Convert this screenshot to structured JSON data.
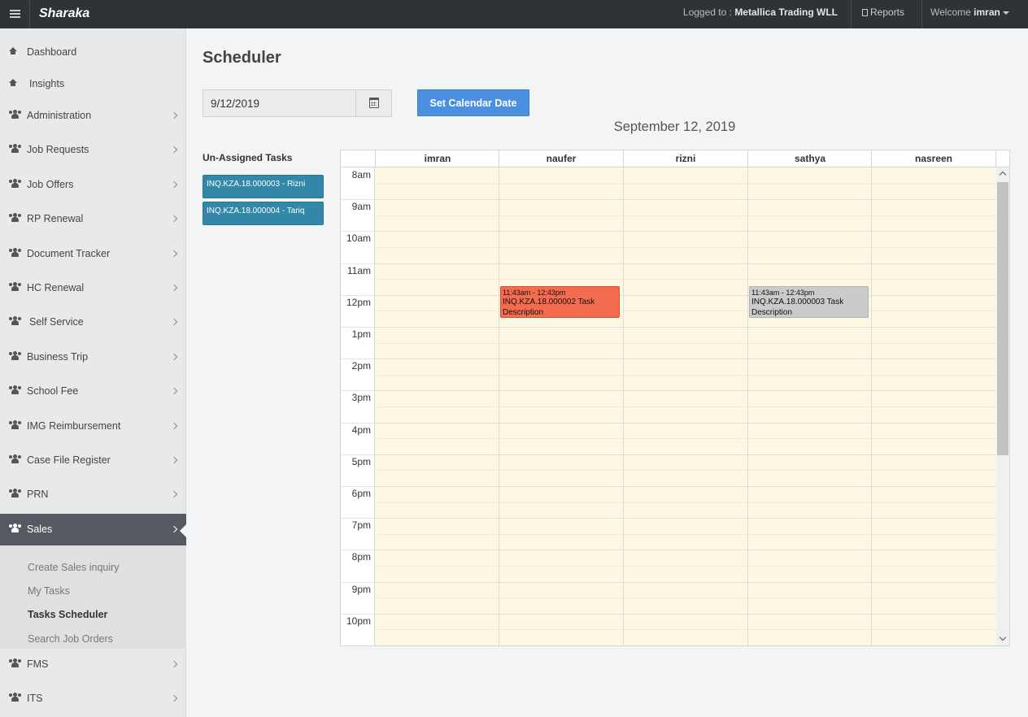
{
  "app": {
    "brand": "Sharaka"
  },
  "topbar": {
    "logged_label": "Logged to :",
    "company": "Metallica Trading WLL",
    "reports": "Reports",
    "welcome_label": "Welcome",
    "user": "imran"
  },
  "sidebar": {
    "items": [
      {
        "label": "Dashboard",
        "icon": "home-icon"
      },
      {
        "label": "Insights",
        "icon": "home-icon"
      },
      {
        "label": "Administration",
        "icon": "users-icon"
      },
      {
        "label": "Job Requests",
        "icon": "users-icon"
      },
      {
        "label": "Job Offers",
        "icon": "users-icon"
      },
      {
        "label": "RP Renewal",
        "icon": "users-icon"
      },
      {
        "label": "Document Tracker",
        "icon": "users-icon"
      },
      {
        "label": "HC Renewal",
        "icon": "users-icon"
      },
      {
        "label": "Self Service",
        "icon": "users-icon"
      },
      {
        "label": "Business Trip",
        "icon": "users-icon"
      },
      {
        "label": "School Fee",
        "icon": "users-icon"
      },
      {
        "label": "IMG Reimbursement",
        "icon": "users-icon"
      },
      {
        "label": "Case File Register",
        "icon": "users-icon"
      },
      {
        "label": "PRN",
        "icon": "users-icon"
      },
      {
        "label": "Sales",
        "icon": "users-icon",
        "active": true
      },
      {
        "label": "FMS",
        "icon": "users-icon"
      },
      {
        "label": "ITS",
        "icon": "users-icon"
      }
    ],
    "sales_submenu": [
      "Create Sales inquiry",
      "My Tasks",
      "Tasks Scheduler",
      "Search Job Orders"
    ],
    "current_submenu": "Tasks Scheduler"
  },
  "main": {
    "title": "Scheduler",
    "date_value": "9/12/2019",
    "set_button": "Set Calendar Date",
    "calendar_date": "September 12, 2019",
    "unassigned_title": "Un-Assigned Tasks",
    "unassigned_tasks": [
      "INQ.KZA.18.000003 - Rizni",
      "INQ.KZA.18.000004 - Tariq"
    ]
  },
  "scheduler": {
    "resources": [
      "imran",
      "naufer",
      "rizni",
      "sathya",
      "nasreen"
    ],
    "hours": [
      "8am",
      "9am",
      "10am",
      "11am",
      "12pm",
      "1pm",
      "2pm",
      "3pm",
      "4pm",
      "5pm",
      "6pm",
      "7pm",
      "8pm",
      "9pm",
      "10pm"
    ],
    "events": [
      {
        "resource": "naufer",
        "time": "11:43am - 12:43pm",
        "title": "INQ.KZA.18.000002 Task Description",
        "color": "#f36c4f"
      },
      {
        "resource": "sathya",
        "time": "11:43am - 12:43pm",
        "title": "INQ.KZA.18.000003 Task Description",
        "color": "#cbcbcb"
      }
    ]
  },
  "colors": {
    "accent": "#4a8fe0",
    "task_chip": "#3387a7",
    "grid_bg": "#fcf8e3",
    "topbar": "#2f3337",
    "active_nav": "#555960"
  }
}
